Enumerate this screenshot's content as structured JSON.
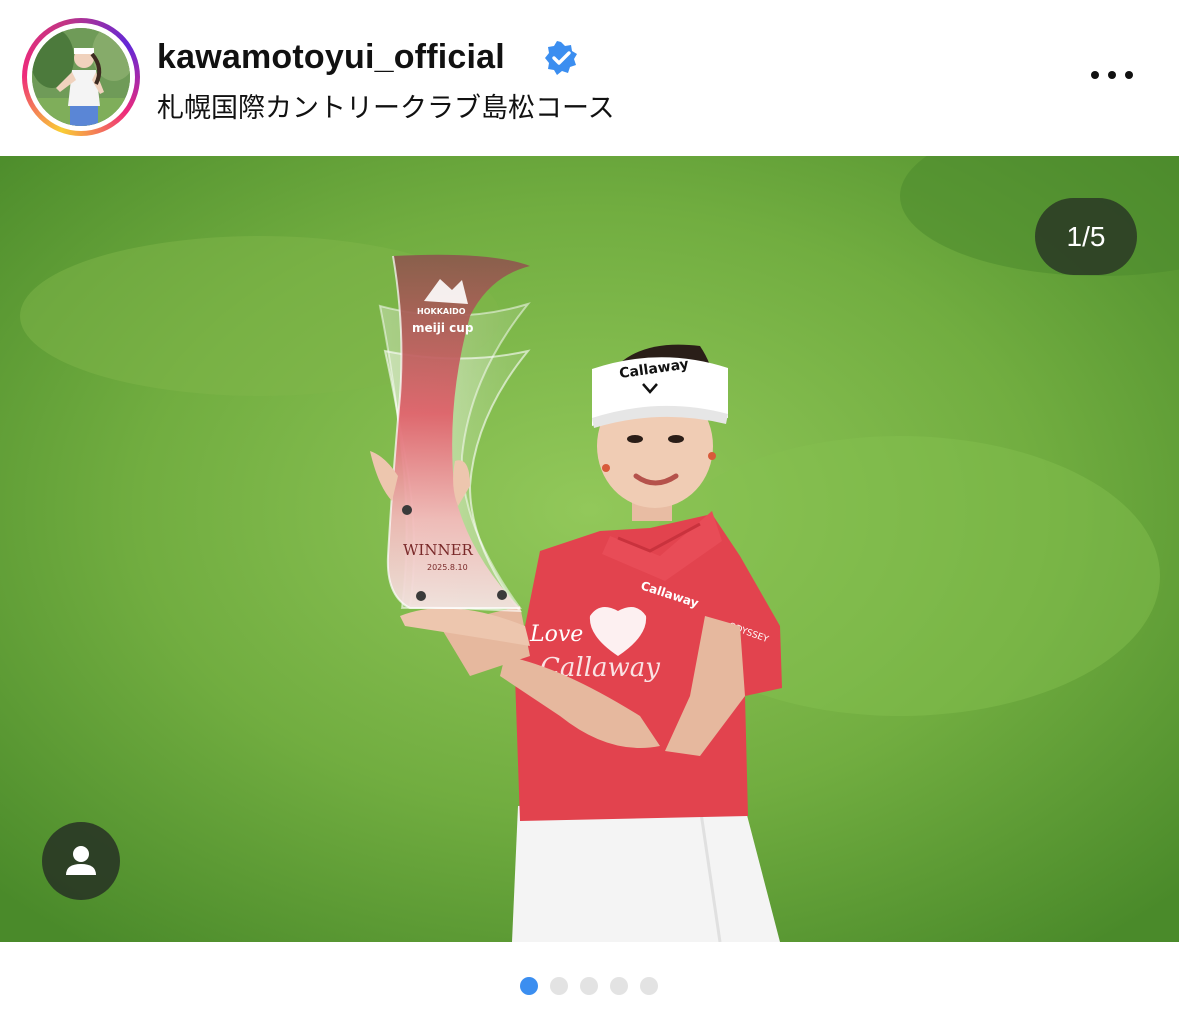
{
  "post": {
    "username": "kawamotoyui_official",
    "location": "札幌国際カントリークラブ島松コース",
    "verified": true
  },
  "icons": {
    "verified": "verified-badge-icon",
    "more": "more-options-icon",
    "tags": "user-tag-icon"
  },
  "carousel": {
    "counter": "1/5",
    "current": 1,
    "total": 5
  },
  "trophy": {
    "brand_top": "HOKKAIDO",
    "brand": "meiji cup",
    "inscription": "WINNER",
    "date": "2025.8.10"
  },
  "apparel": {
    "visor_logo": "Callaway",
    "shirt_logo": "Callaway",
    "sleeve_logo": "ODYSSEY",
    "shirt_script": "Love Callaway"
  },
  "colors": {
    "accent": "#3b8ef0",
    "dot_inactive": "#e3e3e3",
    "grass": "#6fae3d",
    "shirt": "#e2434e"
  }
}
